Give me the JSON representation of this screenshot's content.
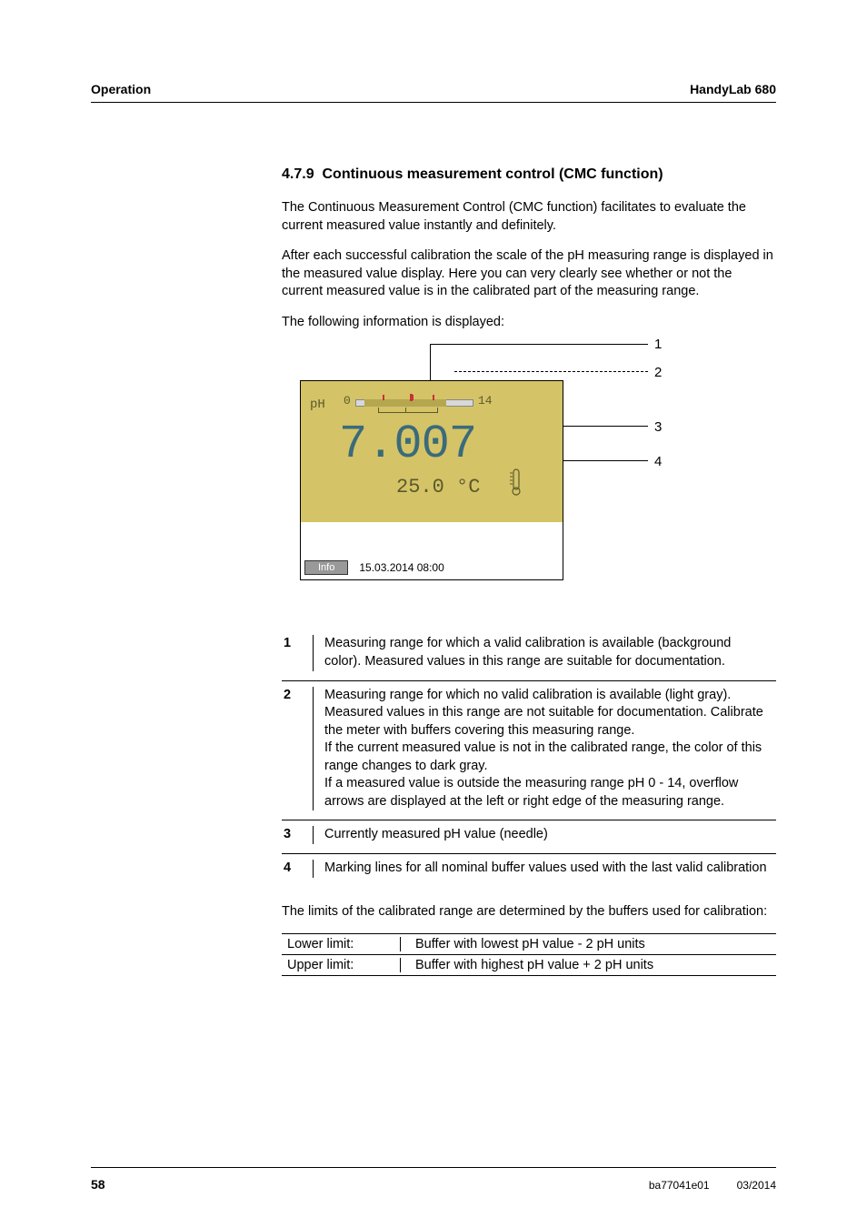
{
  "header": {
    "left": "Operation",
    "right": "HandyLab 680"
  },
  "section": {
    "number": "4.7.9",
    "title": "Continuous measurement control (CMC function)"
  },
  "paragraphs": {
    "p1": "The Continuous Measurement Control (CMC function) facilitates to evaluate the current measured value instantly and definitely.",
    "p2": "After each successful calibration the scale of the pH measuring range is displayed in the measured value display. Here you can very clearly see whether or not the current measured value is in the calibrated part of the measuring range.",
    "p3": "The following information is displayed:",
    "p4": "The limits of the calibrated range are determined by the buffers used for calibration:"
  },
  "display": {
    "unit_label": "pH",
    "scale_min": "0",
    "scale_max": "14",
    "value": "7.007",
    "temperature": "25.0 °C",
    "info_button": "Info",
    "timestamp": "15.03.2014 08:00"
  },
  "callouts": {
    "n1": "1",
    "n2": "2",
    "n3": "3",
    "n4": "4"
  },
  "definitions": [
    {
      "num": "1",
      "text": "Measuring range for which a valid calibration is available (background color). Measured values in this range are suitable for documentation."
    },
    {
      "num": "2",
      "text": "Measuring range for which no valid calibration is available (light gray). Measured values in this range are not suitable for documentation. Calibrate the meter with buffers covering this measuring range.\nIf the current measured value is not in the calibrated range, the color of this range changes to dark gray.\nIf a measured value is outside the measuring range pH 0 - 14, overflow arrows are displayed at the left or right edge of the measuring range."
    },
    {
      "num": "3",
      "text": "Currently measured pH value (needle)"
    },
    {
      "num": "4",
      "text": "Marking lines for all nominal buffer values used with the last valid calibration"
    }
  ],
  "limits": {
    "lower_label": "Lower limit:",
    "lower_value": "Buffer with lowest pH value - 2 pH units",
    "upper_label": "Upper limit:",
    "upper_value": "Buffer with highest pH value + 2 pH units"
  },
  "footer": {
    "page": "58",
    "docid": "ba77041e01",
    "date": "03/2014"
  }
}
